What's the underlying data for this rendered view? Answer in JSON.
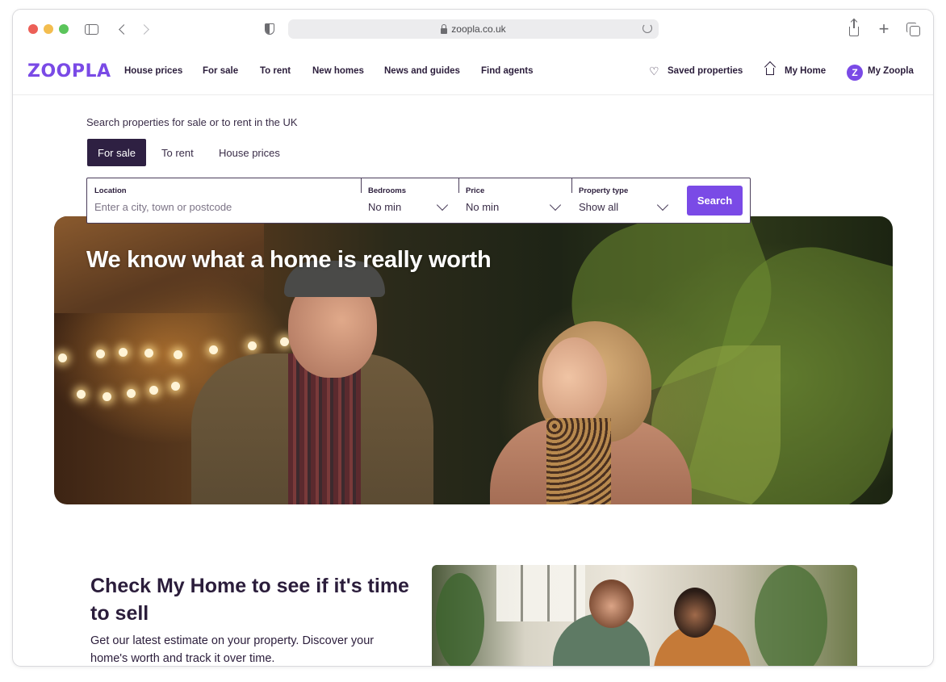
{
  "browser": {
    "url": "zoopla.co.uk"
  },
  "header": {
    "logo": "ZOOPLA",
    "nav": [
      "House prices",
      "For sale",
      "To rent",
      "New homes",
      "News and guides",
      "Find agents"
    ],
    "saved": "Saved properties",
    "my_home": "My Home",
    "my_zoopla": "My Zoopla",
    "badge_letter": "Z"
  },
  "search": {
    "heading": "Search properties for sale or to rent in the UK",
    "tabs": [
      "For sale",
      "To rent",
      "House prices"
    ],
    "active_tab": "For sale",
    "location": {
      "label": "Location",
      "placeholder": "Enter a city, town or postcode"
    },
    "bedrooms": {
      "label": "Bedrooms",
      "value": "No min"
    },
    "price": {
      "label": "Price",
      "value": "No min"
    },
    "property_type": {
      "label": "Property type",
      "value": "Show all"
    },
    "button": "Search"
  },
  "hero": {
    "title": "We know what a home is really worth"
  },
  "check_my_home": {
    "title": "Check My Home to see if it's time to sell",
    "text": "Get our latest estimate on your property. Discover your home's worth and track it over time."
  },
  "colors": {
    "brand": "#7a4ae6",
    "dark": "#2e2042"
  }
}
